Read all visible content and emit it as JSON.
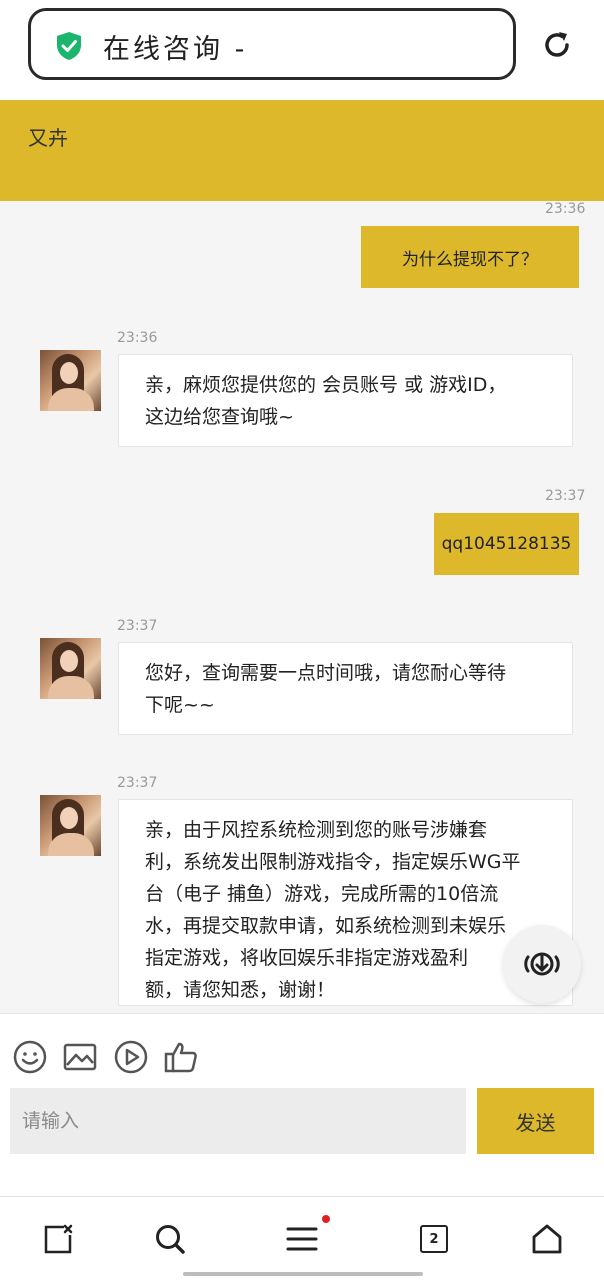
{
  "browser": {
    "title": "在线咨询 -",
    "shield_color": "#1bb56e"
  },
  "chat": {
    "agent_name": "又卉",
    "accent": "#dcb82a",
    "messages": [
      {
        "side": "out",
        "time": "23:36",
        "text": "为什么提现不了？"
      },
      {
        "side": "in",
        "time": "23:36",
        "lines": [
          "亲，麻烦您提供您的 会员账号 或 游戏ID，",
          "这边给您查询哦~"
        ]
      },
      {
        "side": "out",
        "time": "23:37",
        "text": "qq1045128135"
      },
      {
        "side": "in",
        "time": "23:37",
        "lines": [
          "您好，查询需要一点时间哦，请您耐心等待",
          "下呢~~"
        ]
      },
      {
        "side": "in",
        "time": "23:37",
        "lines": [
          "亲，由于风控系统检测到您的账号涉嫌套",
          "利，系统发出限制游戏指令，指定娱乐WG平",
          "台（电子 捕鱼）游戏，完成所需的10倍流",
          "水，再提交取款申请，如系统检测到未娱乐",
          "指定游戏，将收回娱乐非指定游戏盈利",
          "额，请您知悉，谢谢！"
        ]
      }
    ]
  },
  "composer": {
    "placeholder": "请输入",
    "send_label": "发送",
    "tools": [
      "emoji-icon",
      "image-icon",
      "video-icon",
      "thumbs-up-icon"
    ]
  },
  "navbar": {
    "tab_count": "2",
    "items": [
      "close-tab-icon",
      "search-icon",
      "menu-icon",
      "tabs-icon",
      "home-icon"
    ]
  }
}
